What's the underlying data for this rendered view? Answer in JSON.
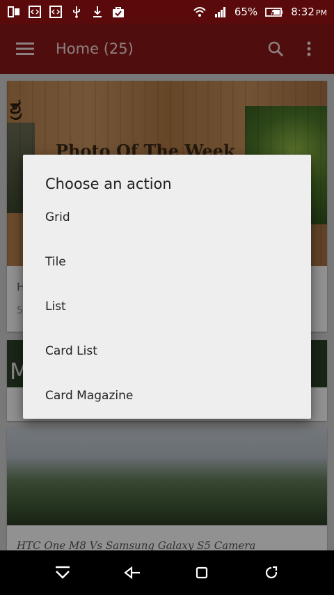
{
  "status_bar": {
    "battery_percent": "65%",
    "time": "8:32",
    "time_suffix": "PM"
  },
  "app_bar": {
    "title": "Home (25)"
  },
  "background": {
    "card1_logo": "ಶ್ರ",
    "card1_hero_title": "Photo Of The Week",
    "card1_meta": "H",
    "card1_meta2": "5",
    "card2_strip_text": "M",
    "card3_caption": "HTC One M8 Vs Samsung Galaxy S5 Camera"
  },
  "dialog": {
    "title": "Choose an action",
    "items": [
      {
        "label": "Grid"
      },
      {
        "label": "Tile"
      },
      {
        "label": "List"
      },
      {
        "label": "Card List"
      },
      {
        "label": "Card Magazine"
      }
    ]
  },
  "colors": {
    "status_bar": "#5a0a0a",
    "app_bar": "#8a1717",
    "dialog_bg": "#eeeeee"
  }
}
